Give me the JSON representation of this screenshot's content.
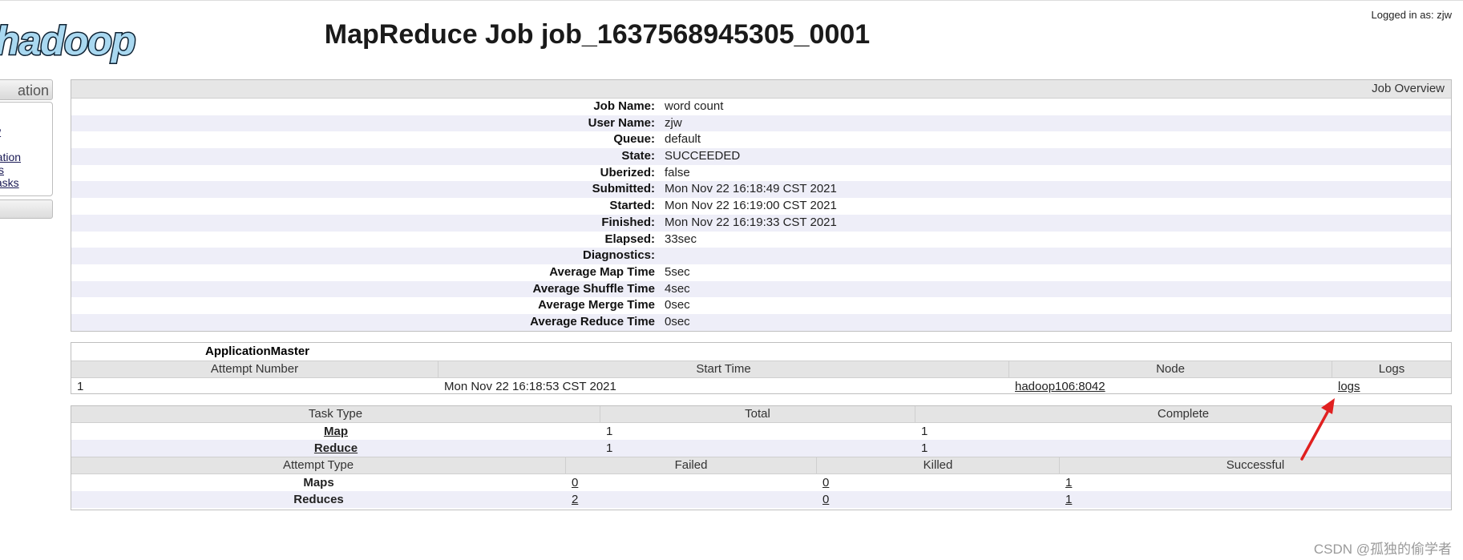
{
  "header": {
    "logo_text": "hadoop",
    "title": "MapReduce Job job_1637568945305_0001",
    "logged_in": "Logged in as: zjw"
  },
  "nav": {
    "heading": "ation",
    "links": [
      "w",
      "s",
      "ration",
      "ks",
      "tasks"
    ]
  },
  "overview": {
    "header": "Job Overview",
    "rows": [
      {
        "label": "Job Name:",
        "value": "word count"
      },
      {
        "label": "User Name:",
        "value": "zjw"
      },
      {
        "label": "Queue:",
        "value": "default"
      },
      {
        "label": "State:",
        "value": "SUCCEEDED"
      },
      {
        "label": "Uberized:",
        "value": "false"
      },
      {
        "label": "Submitted:",
        "value": "Mon Nov 22 16:18:49 CST 2021"
      },
      {
        "label": "Started:",
        "value": "Mon Nov 22 16:19:00 CST 2021"
      },
      {
        "label": "Finished:",
        "value": "Mon Nov 22 16:19:33 CST 2021"
      },
      {
        "label": "Elapsed:",
        "value": "33sec"
      },
      {
        "label": "Diagnostics:",
        "value": ""
      },
      {
        "label": "Average Map Time",
        "value": "5sec"
      },
      {
        "label": "Average Shuffle Time",
        "value": "4sec"
      },
      {
        "label": "Average Merge Time",
        "value": "0sec"
      },
      {
        "label": "Average Reduce Time",
        "value": "0sec"
      }
    ]
  },
  "app_master": {
    "title": "ApplicationMaster",
    "columns": [
      "Attempt Number",
      "Start Time",
      "Node",
      "Logs"
    ],
    "row": {
      "attempt": "1",
      "start_time": "Mon Nov 22 16:18:53 CST 2021",
      "node": "hadoop106:8042",
      "logs": "logs"
    }
  },
  "tasks": {
    "columns": [
      "Task Type",
      "Total",
      "Complete"
    ],
    "rows": [
      {
        "type": "Map",
        "total": "1",
        "complete": "1"
      },
      {
        "type": "Reduce",
        "total": "1",
        "complete": "1"
      }
    ]
  },
  "attempts": {
    "columns": [
      "Attempt Type",
      "Failed",
      "Killed",
      "Successful"
    ],
    "rows": [
      {
        "type": "Maps",
        "failed": "0",
        "killed": "0",
        "successful": "1"
      },
      {
        "type": "Reduces",
        "failed": "2",
        "killed": "0",
        "successful": "1"
      }
    ]
  },
  "watermark": "CSDN @孤独的偷学者",
  "colors": {
    "annotation_arrow": "#e02020",
    "logo_fill": "#a9d8f0"
  }
}
